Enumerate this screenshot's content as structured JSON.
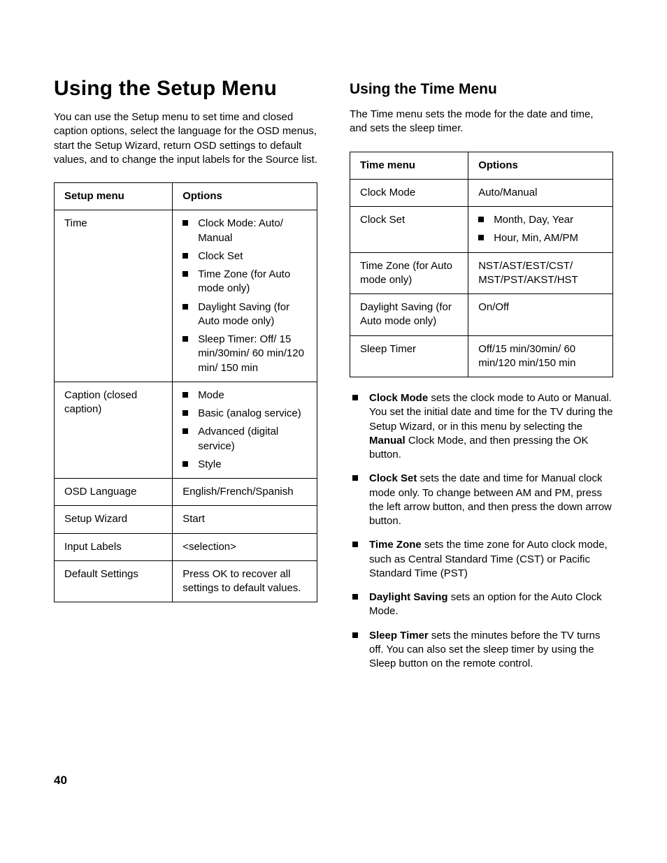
{
  "page_number": "40",
  "left": {
    "heading": "Using the Setup Menu",
    "intro": "You can use the Setup menu to set time and closed caption options, select the language for the OSD menus, start the Setup Wizard, return OSD settings to default values, and to change the input labels for the Source list.",
    "table": {
      "head": {
        "c1": "Setup menu",
        "c2": "Options"
      },
      "rows": [
        {
          "c1": "Time",
          "c2_list": [
            "Clock Mode: Auto/\nManual",
            "Clock Set",
            "Time Zone (for Auto mode only)",
            "Daylight Saving (for Auto mode only)",
            "Sleep Timer: Off/\n15 min/30min/\n60 min/120 min/\n150 min"
          ]
        },
        {
          "c1": "Caption (closed caption)",
          "c2_list": [
            "Mode",
            "Basic (analog service)",
            "Advanced (digital service)",
            "Style"
          ]
        },
        {
          "c1": "OSD Language",
          "c2_text": "English/French/Spanish"
        },
        {
          "c1": "Setup Wizard",
          "c2_text": "Start"
        },
        {
          "c1": "Input Labels",
          "c2_text": "<selection>"
        },
        {
          "c1": "Default Settings",
          "c2_text": "Press OK to recover all settings to default values."
        }
      ]
    }
  },
  "right": {
    "heading": "Using the Time Menu",
    "intro": "The Time menu sets the mode for the date and time, and sets the sleep timer.",
    "table": {
      "head": {
        "c1": "Time menu",
        "c2": "Options"
      },
      "rows": [
        {
          "c1": "Clock Mode",
          "c2_text": "Auto/Manual"
        },
        {
          "c1": "Clock Set",
          "c2_list": [
            "Month, Day, Year",
            "Hour, Min, AM/PM"
          ]
        },
        {
          "c1": "Time Zone (for Auto mode only)",
          "c2_text": "NST/AST/EST/CST/\nMST/PST/AKST/HST"
        },
        {
          "c1": "Daylight Saving (for Auto mode only)",
          "c2_text": "On/Off"
        },
        {
          "c1": "Sleep Timer",
          "c2_text": "Off/15 min/30min/\n60 min/120 min/150 min"
        }
      ]
    },
    "descriptions": [
      {
        "bold": "Clock Mode",
        "rest": " sets the clock mode to Auto or Manual. You set the initial date and time for the TV during the Setup Wizard, or in this menu by selecting the ",
        "bold2": "Manual",
        "rest2": " Clock Mode, and then pressing the OK button."
      },
      {
        "bold": "Clock Set",
        "rest": " sets the date and time for Manual clock mode only. To change between AM and PM, press the left arrow button, and then press the down arrow button."
      },
      {
        "bold": "Time Zone",
        "rest": " sets the time zone for Auto clock mode, such as Central Standard Time (CST) or Pacific Standard Time (PST)"
      },
      {
        "bold": "Daylight Saving",
        "rest": " sets an option for the Auto Clock Mode."
      },
      {
        "bold": "Sleep Timer",
        "rest": " sets the minutes before the TV turns off. You can also set the sleep timer by using the Sleep button on the remote control."
      }
    ]
  }
}
